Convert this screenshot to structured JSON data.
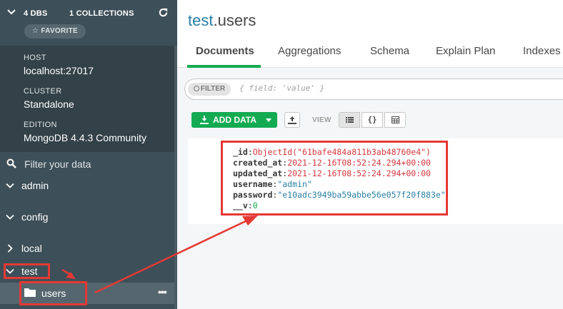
{
  "sidebar": {
    "dbs_count": "4 DBS",
    "collections_count": "1 COLLECTIONS",
    "favorite_label": "☆ FAVORITE",
    "host_label": "HOST",
    "host_value": "localhost:27017",
    "cluster_label": "CLUSTER",
    "cluster_value": "Standalone",
    "edition_label": "EDITION",
    "edition_value": "MongoDB 4.4.3 Community",
    "filter_placeholder": "Filter your data",
    "databases": [
      {
        "name": "admin",
        "expanded": true
      },
      {
        "name": "config",
        "expanded": true
      },
      {
        "name": "local",
        "expanded": false
      },
      {
        "name": "test",
        "expanded": true
      }
    ],
    "collection": "users",
    "more": "•••"
  },
  "main": {
    "namespace_db": "test",
    "namespace_coll": ".users",
    "tabs": [
      "Documents",
      "Aggregations",
      "Schema",
      "Explain Plan",
      "Indexes"
    ],
    "filter_pill": "FILTER",
    "filter_placeholder": "{ field: 'value' }",
    "add_data_label": "ADD DATA",
    "view_label": "VIEW",
    "json_view": "{}"
  },
  "document": [
    {
      "key": "_id",
      "value": "ObjectId(\"61bafe484a811b3ab48760e4\")",
      "type": "oid"
    },
    {
      "key": "created_at",
      "value": "2021-12-16T08:52:24.294+00:00",
      "type": "date"
    },
    {
      "key": "updated_at",
      "value": "2021-12-16T08:52:24.294+00:00",
      "type": "date"
    },
    {
      "key": "username",
      "value": "\"admin\"",
      "type": "str"
    },
    {
      "key": "password",
      "value": "\"e10adc3949ba59abbe56e057f20f883e\"",
      "type": "str"
    },
    {
      "key": "__v",
      "value": "0",
      "type": "num"
    }
  ],
  "colors": {
    "sidebar_bg": "#3d4f58",
    "sidebar_info_bg": "#334249",
    "accent_green": "#13aa52",
    "namespace_blue": "#2a7fa5",
    "annotation_red": "#e53935"
  }
}
